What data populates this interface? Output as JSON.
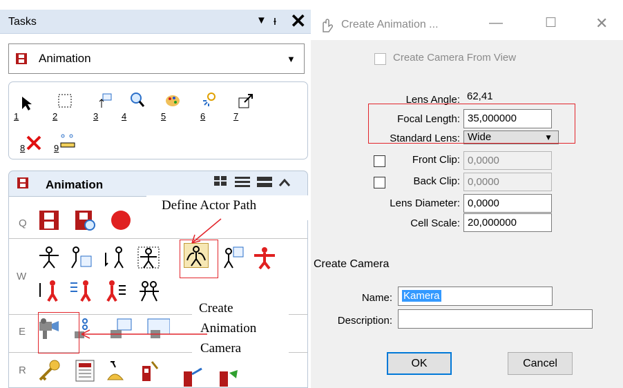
{
  "tasks": {
    "title": "Tasks",
    "dropdown_value": "Animation",
    "tools": [
      "1",
      "2",
      "3",
      "4",
      "5",
      "6",
      "7",
      "8",
      "9"
    ],
    "section_title": "Animation",
    "row_keys": [
      "Q",
      "W",
      "E",
      "R"
    ]
  },
  "annotations": {
    "define_actor_path": "Define Actor Path",
    "create_camera_1": "Create",
    "create_camera_2": "Animation",
    "create_camera_3": "Camera"
  },
  "dialog1": {
    "title": "Create Animation ...",
    "camera_from_view": "Create Camera From View",
    "lens_angle_label": "Lens Angle:",
    "lens_angle_value": "62,41",
    "focal_length_label": "Focal Length:",
    "focal_length_value": "35,000000",
    "standard_lens_label": "Standard Lens:",
    "standard_lens_value": "Wide",
    "front_clip_label": "Front Clip:",
    "front_clip_value": "0,0000",
    "back_clip_label": "Back Clip:",
    "back_clip_value": "0,0000",
    "lens_diameter_label": "Lens Diameter:",
    "lens_diameter_value": "0,0000",
    "cell_scale_label": "Cell Scale:",
    "cell_scale_value": "20,000000"
  },
  "dialog2": {
    "title": "Create Camera",
    "name_label": "Name:",
    "name_value": "Kamera",
    "description_label": "Description:",
    "description_value": "",
    "ok_label": "OK",
    "cancel_label": "Cancel"
  },
  "colors": {
    "accent_red": "#e2242a",
    "selection_blue": "#3399ff",
    "default_button_border": "#0078d7"
  }
}
